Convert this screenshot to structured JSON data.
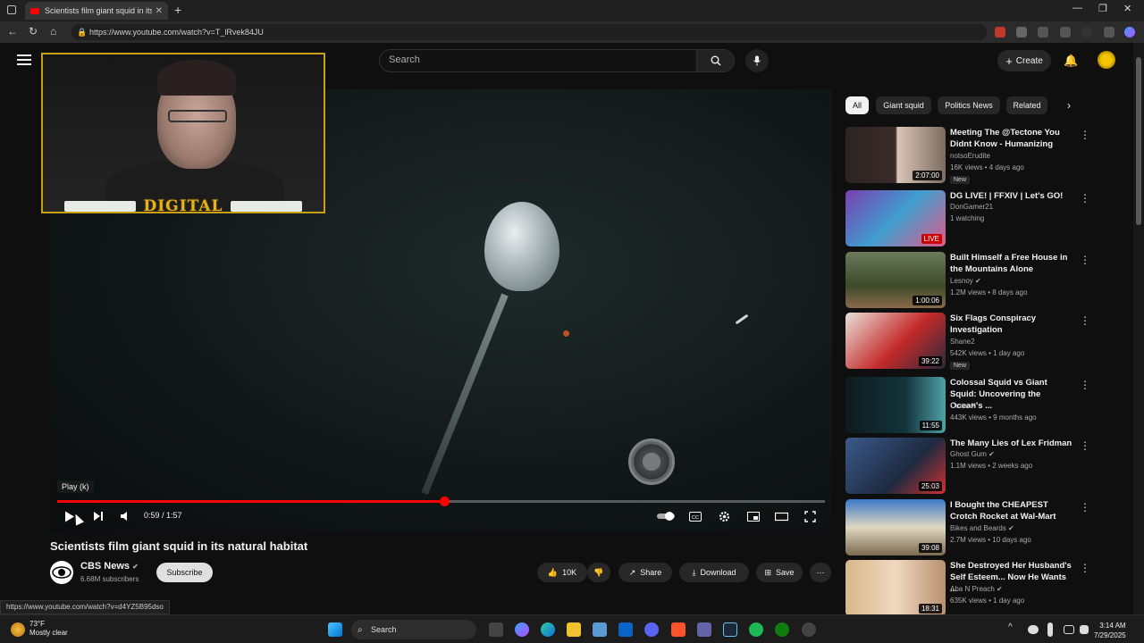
{
  "browser": {
    "tab_title": "Scientists film giant squid in its natural habitat",
    "url": "https://www.youtube.com/watch?v=T_lRvek84JU",
    "status_url": "https://www.youtube.com/watch?v=d4YZ5B95dso"
  },
  "header": {
    "search_placeholder": "Search",
    "create_label": "Create"
  },
  "player": {
    "tooltip": "Play (k)",
    "time": "0:59 / 1:57",
    "progress_fraction": 0.504
  },
  "webcam": {
    "logo_text": "DIGITAL"
  },
  "video": {
    "title": "Scientists film giant squid in its natural habitat",
    "channel": "CBS News",
    "subscribers": "6.68M subscribers",
    "subscribe_label": "Subscribe",
    "likes": "10K",
    "share_label": "Share",
    "download_label": "Download",
    "save_label": "Save"
  },
  "chips": [
    "All",
    "Giant squid",
    "Politics News",
    "Related"
  ],
  "recommendations": [
    {
      "title": "Meeting The @Tectone You Didnt Know - Humanizing",
      "channel": "notsoErudite",
      "meta": "16K views • 4 days ago",
      "duration": "2:07:00",
      "badge": "New",
      "live": false,
      "verified": false
    },
    {
      "title": "DG LIVE! | FFXIV | Let's GO!",
      "channel": "DonGamer21",
      "meta": "1 watching",
      "duration": "LIVE",
      "badge": "",
      "live": true,
      "verified": false
    },
    {
      "title": "Built Himself a Free House in the Mountains Alone",
      "channel": "Lesnoy",
      "meta": "1.2M views • 8 days ago",
      "duration": "1:00:06",
      "badge": "",
      "live": false,
      "verified": true
    },
    {
      "title": "Six Flags Conspiracy Investigation",
      "channel": "Shane2",
      "meta": "542K views • 1 day ago",
      "duration": "39:22",
      "badge": "New",
      "live": false,
      "verified": false
    },
    {
      "title": "Colossal Squid vs Giant Squid: Uncovering the Ocean's ...",
      "channel": "OceanX",
      "meta": "443K views • 9 months ago",
      "duration": "11:55",
      "badge": "",
      "live": false,
      "verified": false
    },
    {
      "title": "The Many Lies of Lex Fridman",
      "channel": "Ghost Gum",
      "meta": "1.1M views • 2 weeks ago",
      "duration": "25:03",
      "badge": "",
      "live": false,
      "verified": true
    },
    {
      "title": "I Bought the CHEAPEST Crotch Rocket at Wal-Mart",
      "channel": "Bikes and Beards",
      "meta": "2.7M views • 10 days ago",
      "duration": "39:08",
      "badge": "",
      "live": false,
      "verified": true
    },
    {
      "title": "She Destroyed Her Husband's Self Esteem... Now He Wants ...",
      "channel": "Aba N Preach",
      "meta": "635K views • 1 day ago",
      "duration": "18:31",
      "badge": "",
      "live": false,
      "verified": true
    }
  ],
  "taskbar": {
    "temperature": "73°F",
    "weather": "Mostly clear",
    "search_label": "Search",
    "time": "3:14 AM",
    "date": "7/29/2025"
  },
  "colors": {
    "accent": "#ff0000",
    "background": "#0f0f0f",
    "webcam_border": "#c8a018"
  },
  "icons": [
    "hamburger-icon",
    "search-icon",
    "mic-icon",
    "plus-icon",
    "bell-icon",
    "play-icon",
    "next-icon",
    "volume-icon",
    "autoplay-toggle-icon",
    "cc-icon",
    "settings-icon",
    "miniplayer-icon",
    "theater-icon",
    "fullscreen-icon",
    "like-icon",
    "dislike-icon",
    "share-icon",
    "download-icon",
    "save-icon",
    "more-icon"
  ]
}
